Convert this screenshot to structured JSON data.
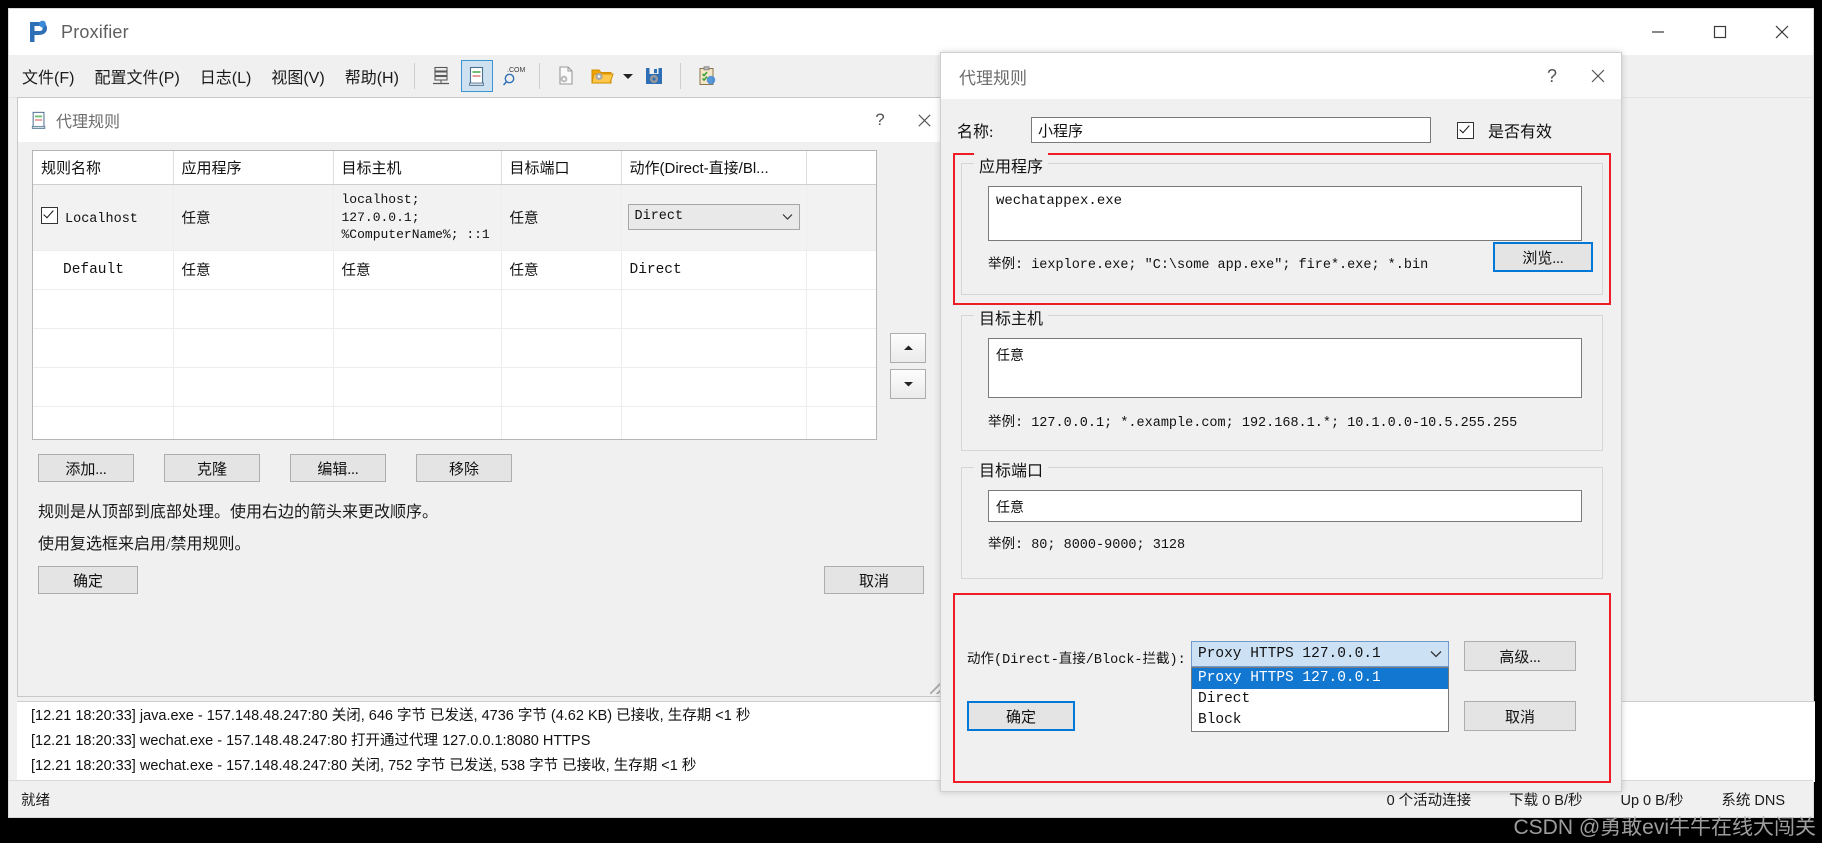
{
  "app": {
    "title": "Proxifier",
    "logo_icon": "proxifier-logo-icon",
    "minimize_icon": "minimize-icon",
    "maximize_icon": "maximize-icon",
    "close_icon": "close-icon"
  },
  "menubar": {
    "items": [
      {
        "label": "文件(F)"
      },
      {
        "label": "配置文件(P)"
      },
      {
        "label": "日志(L)"
      },
      {
        "label": "视图(V)"
      },
      {
        "label": "帮助(H)"
      }
    ],
    "toolbar": [
      {
        "icon": "connections-icon"
      },
      {
        "icon": "proxy-rules-icon",
        "active": true
      },
      {
        "icon": "dotcom-search-icon"
      },
      {
        "icon": "new-profile-icon"
      },
      {
        "icon": "open-profile-icon"
      },
      {
        "icon": "dropdown-caret-icon"
      },
      {
        "icon": "save-profile-icon"
      },
      {
        "icon": "verify-profile-icon"
      }
    ]
  },
  "rules_dialog": {
    "title": "代理规则",
    "title_icon": "proxy-rules-icon",
    "help_label": "?",
    "close_label": "✕",
    "table": {
      "headers": [
        "规则名称",
        "应用程序",
        "目标主机",
        "目标端口",
        "动作(Direct-直接/Bl..."
      ],
      "rows": [
        {
          "name": "Localhost",
          "checked": true,
          "app": "任意",
          "host": "localhost; 127.0.0.1; %ComputerName%; ::1",
          "port": "任意",
          "action": "Direct",
          "action_is_combo": true,
          "selected": true
        },
        {
          "name": "Default",
          "checked": false,
          "app": "任意",
          "host": "任意",
          "port": "任意",
          "action": "Direct",
          "action_is_combo": false,
          "selected": false
        }
      ]
    },
    "spin_up": "▲",
    "spin_down": "▼",
    "buttons": [
      "添加...",
      "克隆",
      "编辑...",
      "移除"
    ],
    "hint1": "规则是从顶部到底部处理。使用右边的箭头来更改顺序。",
    "hint2": "使用复选框来启用/禁用规则。",
    "ok_label": "确定",
    "cancel_label": "取消"
  },
  "rule_dialog": {
    "title": "代理规则",
    "help_label": "?",
    "close_label": "✕",
    "name_label": "名称:",
    "name_value": "小程序",
    "enabled_label": "是否有效",
    "enabled_checked": true,
    "applications": {
      "legend": "应用程序",
      "value": "wechatappex.exe",
      "example": "举例: iexplore.exe; \"C:\\some app.exe\"; fire*.exe; *.bin",
      "browse_label": "浏览..."
    },
    "target_hosts": {
      "legend": "目标主机",
      "value": "任意",
      "example": "举例: 127.0.0.1; *.example.com; 192.168.1.*; 10.1.0.0-10.5.255.255"
    },
    "target_ports": {
      "legend": "目标端口",
      "value": "任意",
      "example": "举例: 80; 8000-9000; 3128"
    },
    "action": {
      "label": "动作(Direct-直接/Block-拦截):",
      "selected": "Proxy HTTPS 127.0.0.1",
      "options": [
        "Proxy HTTPS 127.0.0.1",
        "Direct",
        "Block"
      ],
      "advanced_label": "高级..."
    },
    "ok_label": "确定",
    "cancel_label": "取消"
  },
  "log": {
    "lines": [
      "[12.21 18:20:33] java.exe - 157.148.48.247:80 关闭, 646 字节 已发送, 4736 字节 (4.62 KB) 已接收, 生存期 <1 秒",
      "[12.21 18:20:33] wechat.exe - 157.148.48.247:80 打开通过代理 127.0.0.1:8080 HTTPS",
      "[12.21 18:20:33] wechat.exe - 157.148.48.247:80 关闭, 752 字节 已发送, 538 字节 已接收, 生存期 <1 秒"
    ]
  },
  "statusbar": {
    "state": "就绪",
    "connections": "0 个活动连接",
    "download": "下载 0 B/秒",
    "upload": "Up 0 B/秒",
    "dns": "系统 DNS"
  },
  "watermark": "CSDN @勇敢evi牛牛在线大闯关",
  "colors": {
    "accent": "#0078d7",
    "highlight_red": "#ee1c25",
    "combo_blue": "#1177d1",
    "combo_bg": "#cde1f5"
  }
}
